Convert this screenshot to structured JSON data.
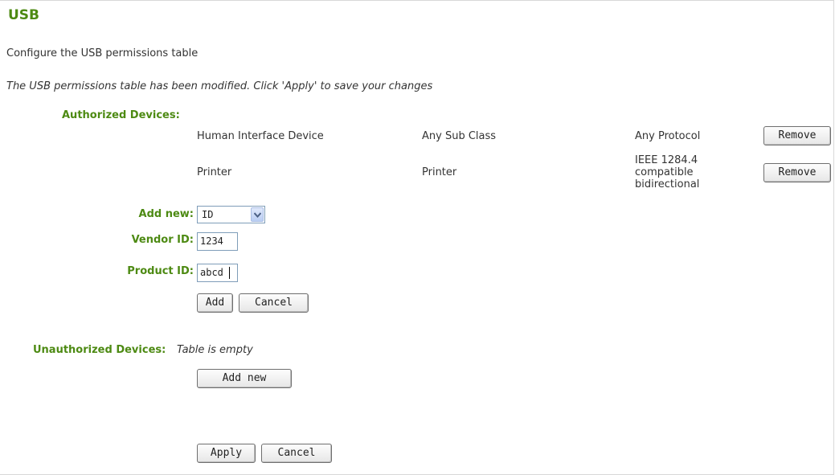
{
  "page": {
    "title": "USB",
    "subtitle": "Configure the USB permissions table",
    "notice": "The USB permissions table has been modified. Click 'Apply' to save your changes"
  },
  "authorized": {
    "label": "Authorized Devices:",
    "rows": [
      {
        "class": "Human Interface Device",
        "subclass": "Any Sub Class",
        "protocol": "Any Protocol",
        "button": "Remove"
      },
      {
        "class": "Printer",
        "subclass": "Printer",
        "protocol_lines": [
          "IEEE 1284.4",
          "compatible",
          "bidirectional"
        ],
        "button": "Remove"
      }
    ]
  },
  "add_form": {
    "add_new_label": "Add new:",
    "add_new_value": "ID",
    "vendor_label": "Vendor ID:",
    "vendor_value": "1234",
    "product_label": "Product ID:",
    "product_value": "abcd",
    "add_button": "Add",
    "cancel_button": "Cancel"
  },
  "unauthorized": {
    "label": "Unauthorized Devices:",
    "empty_text": "Table is empty",
    "add_new_button": "Add new"
  },
  "footer": {
    "apply_button": "Apply",
    "cancel_button": "Cancel"
  },
  "colors": {
    "label_green": "#4d8a13",
    "input_border": "#7f9db9"
  },
  "icons": {
    "select_arrow": "chevron-down-icon"
  }
}
